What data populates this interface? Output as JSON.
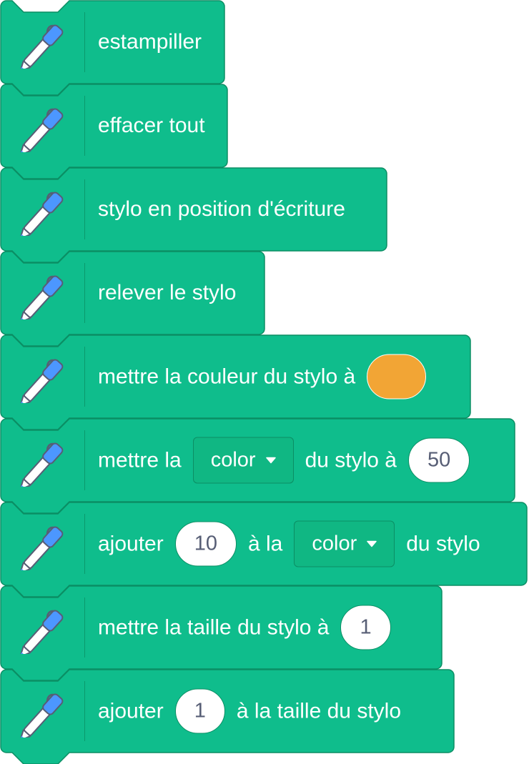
{
  "colors": {
    "block_fill": "#0fbd8c",
    "block_stroke": "#0b8e64",
    "input_text": "#575e75",
    "pen_color_value": "#f2a535"
  },
  "icon": "pen-icon",
  "blocks": [
    {
      "id": "stamp",
      "parts": [
        {
          "t": "label",
          "text": "estampiller"
        }
      ]
    },
    {
      "id": "clear",
      "parts": [
        {
          "t": "label",
          "text": "effacer tout"
        }
      ]
    },
    {
      "id": "pen-down",
      "parts": [
        {
          "t": "label",
          "text": "stylo en position d'écriture"
        }
      ]
    },
    {
      "id": "pen-up",
      "parts": [
        {
          "t": "label",
          "text": "relever le stylo"
        }
      ]
    },
    {
      "id": "set-pen-color-to",
      "parts": [
        {
          "t": "label",
          "text": "mettre la couleur du stylo à"
        },
        {
          "t": "color",
          "value": "#f2a535"
        }
      ]
    },
    {
      "id": "set-pen-param-to",
      "parts": [
        {
          "t": "label",
          "text": "mettre la"
        },
        {
          "t": "dropdown",
          "text": "color"
        },
        {
          "t": "label",
          "text": "du stylo à"
        },
        {
          "t": "number",
          "text": "50"
        }
      ]
    },
    {
      "id": "change-pen-param-by",
      "parts": [
        {
          "t": "label",
          "text": "ajouter"
        },
        {
          "t": "number",
          "text": "10"
        },
        {
          "t": "label",
          "text": "à la"
        },
        {
          "t": "dropdown",
          "text": "color"
        },
        {
          "t": "label",
          "text": "du stylo"
        }
      ]
    },
    {
      "id": "set-pen-size-to",
      "parts": [
        {
          "t": "label",
          "text": "mettre la taille du stylo à"
        },
        {
          "t": "number",
          "text": "1"
        }
      ]
    },
    {
      "id": "change-pen-size-by",
      "parts": [
        {
          "t": "label",
          "text": "ajouter"
        },
        {
          "t": "number",
          "text": "1"
        },
        {
          "t": "label",
          "text": "à la taille du stylo"
        }
      ]
    }
  ]
}
